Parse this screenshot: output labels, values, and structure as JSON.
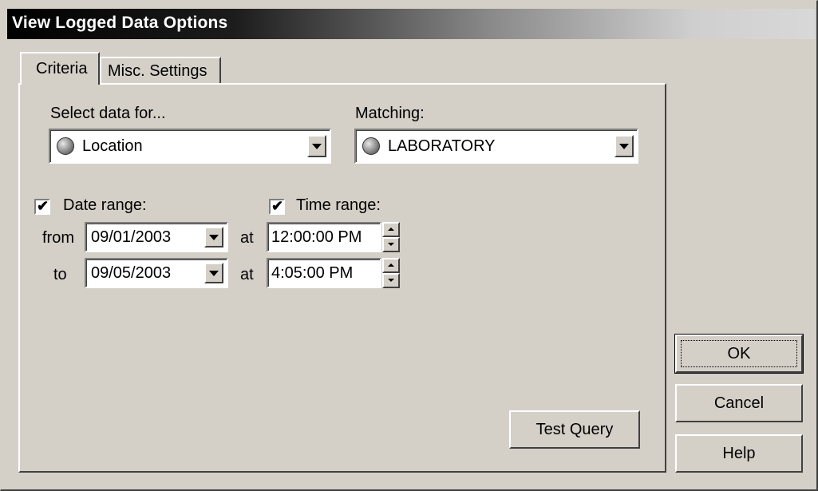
{
  "window": {
    "title": "View Logged Data Options"
  },
  "tabs": [
    {
      "label": "Criteria",
      "active": true
    },
    {
      "label": "Misc. Settings",
      "active": false
    }
  ],
  "criteria": {
    "select_label": "Select data for...",
    "select_value": "Location",
    "select_icon": "globe-icon",
    "matching_label": "Matching:",
    "matching_value": "LABORATORY",
    "matching_icon": "globe-icon",
    "date_range": {
      "label": "Date range:",
      "checked": true,
      "check_glyph": "✔"
    },
    "time_range": {
      "label": "Time range:",
      "checked": true,
      "check_glyph": "✔"
    },
    "from_label": "from",
    "to_label": "to",
    "at_label": "at",
    "from_date": "09/01/2003",
    "to_date": "09/05/2003",
    "from_time": "12:00:00 PM",
    "to_time": "4:05:00 PM",
    "test_query_label": "Test Query"
  },
  "buttons": {
    "ok": "OK",
    "cancel": "Cancel",
    "help": "Help"
  }
}
